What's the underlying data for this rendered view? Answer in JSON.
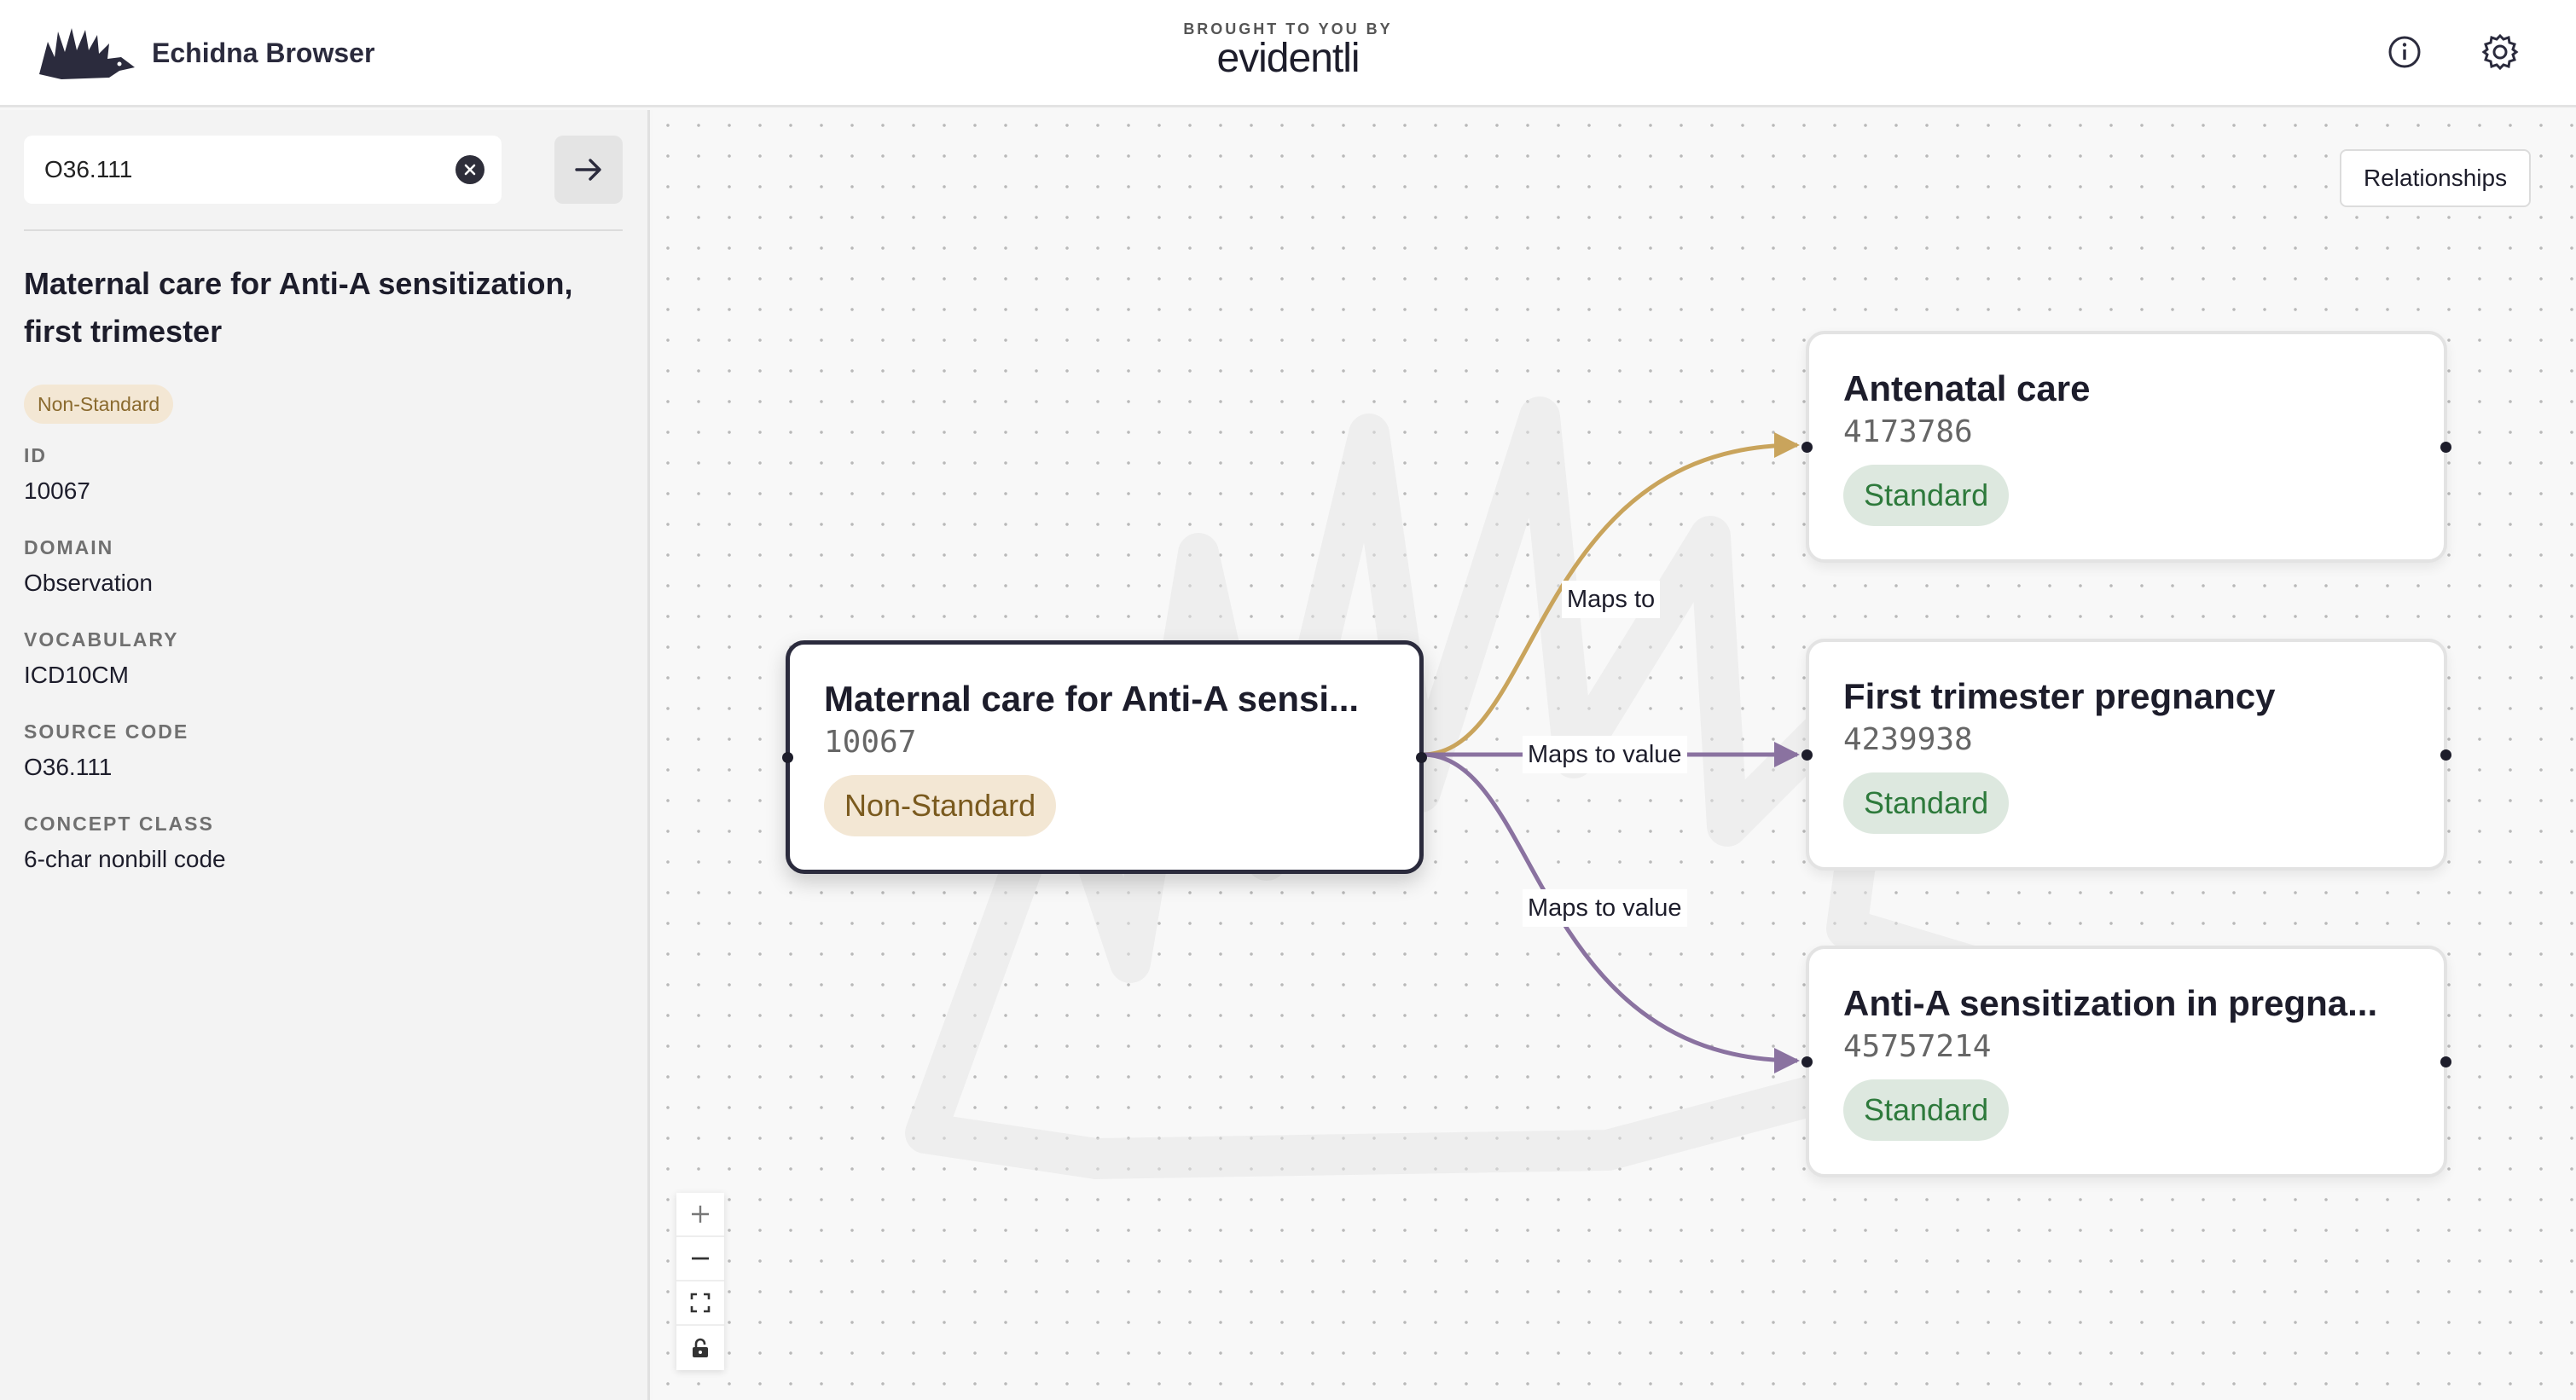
{
  "header": {
    "app_name": "Echidna Browser",
    "sponsor_caption": "BROUGHT TO YOU BY",
    "sponsor_logo": "evidentli",
    "icons": [
      "echidna-logo",
      "info-icon",
      "settings-icon"
    ]
  },
  "search": {
    "value": "O36.111",
    "icons": [
      "clear-icon",
      "arrow-right-icon"
    ]
  },
  "concept": {
    "title": "Maternal care for Anti-A sensitization, first trimester",
    "badge": "Non-Standard",
    "fields": [
      {
        "label": "ID",
        "value": "10067"
      },
      {
        "label": "DOMAIN",
        "value": "Observation"
      },
      {
        "label": "VOCABULARY",
        "value": "ICD10CM"
      },
      {
        "label": "SOURCE CODE",
        "value": "O36.111"
      },
      {
        "label": "CONCEPT CLASS",
        "value": "6-char nonbill code"
      }
    ]
  },
  "graph": {
    "relationships_label": "Relationships",
    "source": {
      "title": "Maternal care for Anti-A sensi...",
      "code": "10067",
      "badge": "Non-Standard"
    },
    "targets": [
      {
        "title": "Antenatal care",
        "code": "4173786",
        "badge": "Standard"
      },
      {
        "title": "First trimester pregnancy",
        "code": "4239938",
        "badge": "Standard"
      },
      {
        "title": "Anti-A sensitization in pregna...",
        "code": "45757214",
        "badge": "Standard"
      }
    ],
    "edges": [
      {
        "label": "Maps to",
        "color": "#c9a45c"
      },
      {
        "label": "Maps to value",
        "color": "#8a72a0"
      },
      {
        "label": "Maps to value",
        "color": "#8a72a0"
      }
    ],
    "controls": [
      "zoom-in-icon",
      "zoom-out-icon",
      "fit-view-icon",
      "lock-icon"
    ]
  }
}
